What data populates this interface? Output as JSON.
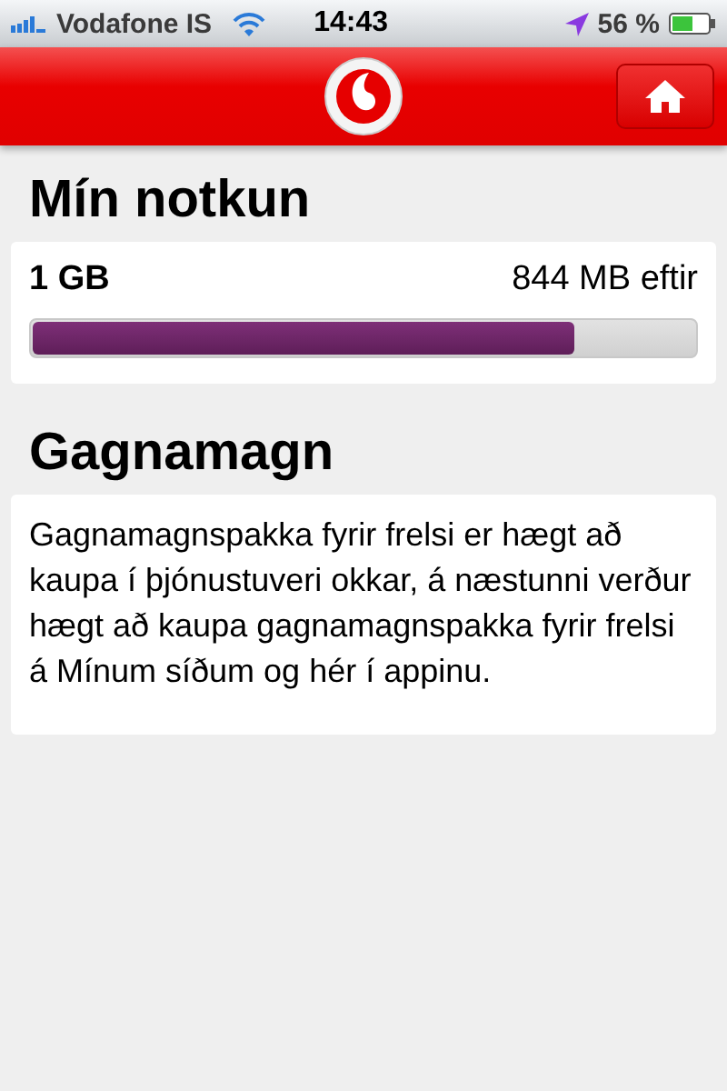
{
  "status_bar": {
    "carrier": "Vodafone IS",
    "time": "14:43",
    "battery": "56 %"
  },
  "usage": {
    "title": "Mín notkun",
    "plan": "1 GB",
    "remaining": "844 MB eftir",
    "level": 0.82
  },
  "info": {
    "title": "Gagnamagn",
    "text": "Gagnamagnspakka fyrir frelsi er hægt að kaupa í þjónustuveri okkar, á næstunni verður hægt að kaupa gagnamagnspakka fyrir frelsi á Mínum síðum og hér í appinu."
  }
}
